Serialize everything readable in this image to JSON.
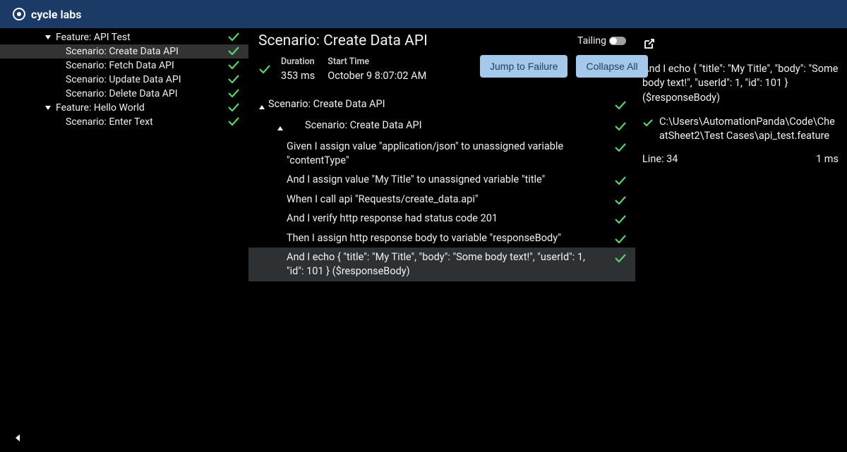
{
  "brand": {
    "name_a": "cycle",
    "name_b": " labs"
  },
  "sidebar": [
    {
      "kind": "feature",
      "label": "Feature: API Test",
      "status": "pass",
      "caret": "down"
    },
    {
      "kind": "scenario",
      "label": "Scenario: Create Data API",
      "status": "pass",
      "selected": true
    },
    {
      "kind": "scenario",
      "label": "Scenario: Fetch Data API",
      "status": "pass"
    },
    {
      "kind": "scenario",
      "label": "Scenario: Update Data API",
      "status": "pass"
    },
    {
      "kind": "scenario",
      "label": "Scenario: Delete Data API",
      "status": "pass"
    },
    {
      "kind": "feature",
      "label": "Feature: Hello World",
      "status": "pass",
      "caret": "down"
    },
    {
      "kind": "scenario",
      "label": "Scenario: Enter Text",
      "status": "pass"
    }
  ],
  "center": {
    "title": "Scenario: Create Data API",
    "tailing_label": "Tailing",
    "duration_label": "Duration",
    "duration_value": "353 ms",
    "start_label": "Start Time",
    "start_value": "October 9 8:07:02 AM",
    "jump_btn": "Jump to Failure",
    "collapse_btn": "Collapse All"
  },
  "steps": [
    {
      "level": 0,
      "caret": "up",
      "text": "Scenario: Create Data API",
      "status": "pass"
    },
    {
      "level": 1,
      "caret": "up",
      "text": "Scenario: Create Data API",
      "status": "pass"
    },
    {
      "level": 2,
      "leaf": true,
      "text": "Given I assign value \"application/json\" to unassigned variable \"contentType\"",
      "status": "pass"
    },
    {
      "level": 2,
      "leaf": true,
      "text": "And I assign value \"My Title\" to unassigned variable \"title\"",
      "status": "pass"
    },
    {
      "level": 2,
      "leaf": true,
      "text": "When I call api \"Requests/create_data.api\"",
      "status": "pass"
    },
    {
      "level": 2,
      "leaf": true,
      "text": "And I verify http response had status code 201",
      "status": "pass"
    },
    {
      "level": 2,
      "leaf": true,
      "text": "Then I assign http response body to variable \"responseBody\"",
      "status": "pass"
    },
    {
      "level": 2,
      "leaf": true,
      "text": "And I echo { \"title\": \"My Title\", \"body\": \"Some body text!\", \"userId\": 1, \"id\": 101 } ($responseBody)",
      "status": "pass",
      "selected": true
    }
  ],
  "right": {
    "echo": "And I echo { \"title\": \"My Title\", \"body\": \"Some body text!\", \"userId\": 1, \"id\": 101 } ($responseBody)",
    "file": "C:\\Users\\AutomationPanda\\Code\\CheatSheet2\\Test Cases\\api_test.feature",
    "line_label": "Line: 34",
    "duration": "1 ms"
  }
}
